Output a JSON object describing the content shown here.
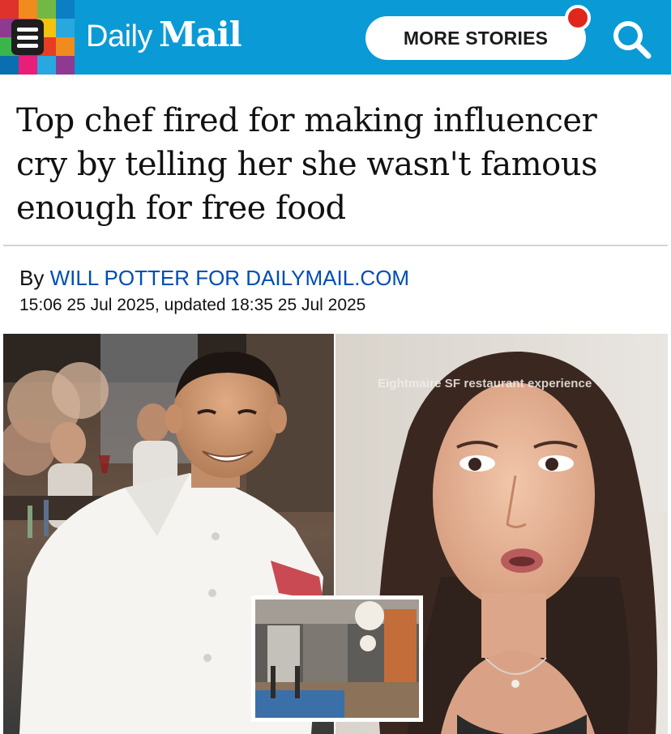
{
  "header": {
    "logo_daily": "Daily",
    "logo_mail": "Mail",
    "more_stories": "MORE STORIES",
    "brand_color": "#0a9ad6",
    "notification_color": "#e1261c",
    "grid_colors": [
      "#e0322d",
      "#f08b1d",
      "#71b944",
      "#0c7ec4",
      "#8e3a91",
      "#e91e78",
      "#f4c20f",
      "#29a8df",
      "#3ab54a",
      "#7e3c96",
      "#e63d25",
      "#f08b1d",
      "#0a6fb0",
      "#e91e78",
      "#29a8df",
      "#8e3a91"
    ]
  },
  "article": {
    "headline": "Top chef fired for making influencer cry by telling her she wasn't famous enough for free food",
    "by_prefix": "By ",
    "author": "WILL POTTER FOR DAILYMAIL.COM",
    "timestamp": "15:06 25 Jul 2025, updated 18:35 25 Jul 2025"
  },
  "photo": {
    "overlay_caption": "Eightmaire SF restaurant experience",
    "left_subject": "chef in white jacket in restaurant",
    "right_subject": "influencer speaking to camera",
    "inset_subject": "restaurant interior"
  },
  "icons": {
    "menu": "menu-icon",
    "search": "search-icon"
  }
}
